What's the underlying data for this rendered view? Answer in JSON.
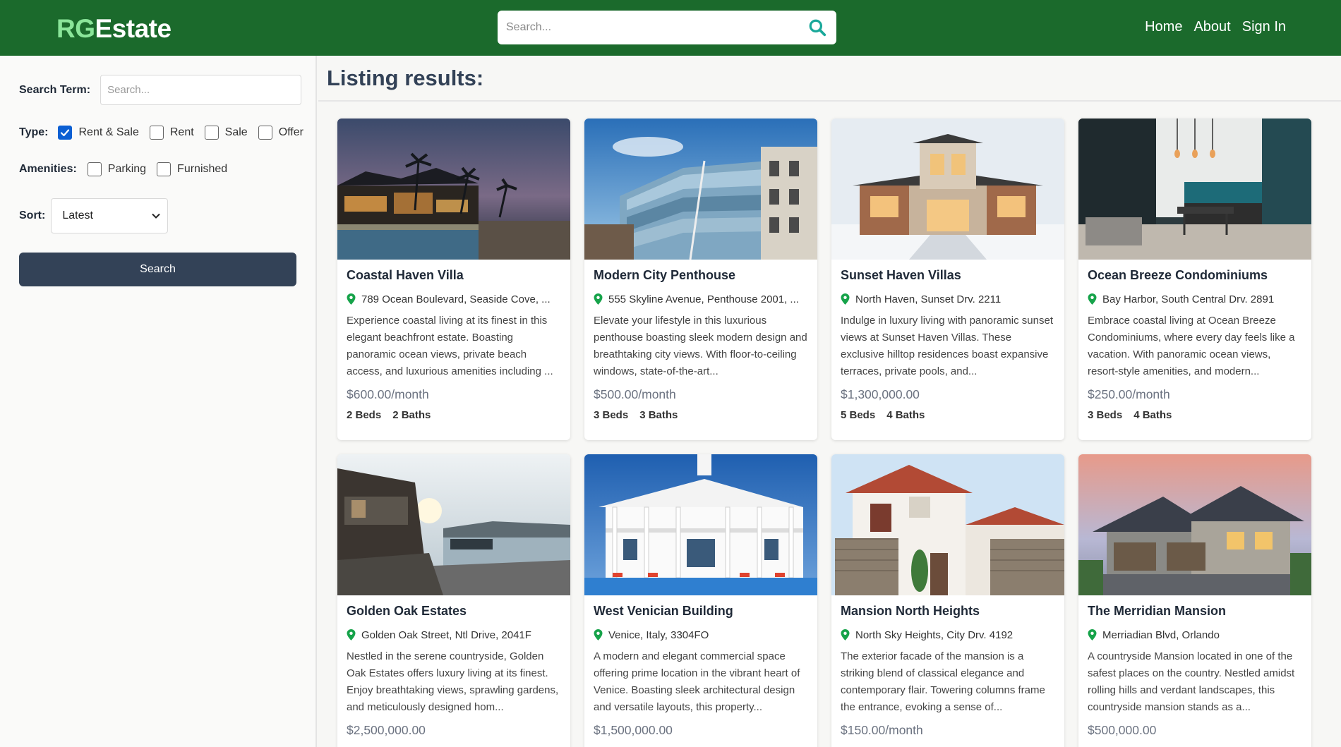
{
  "header": {
    "logo_part1": "RG",
    "logo_part2": "Estate",
    "search_placeholder": "Search...",
    "nav": [
      "Home",
      "About",
      "Sign In"
    ]
  },
  "filters": {
    "search_term_label": "Search Term:",
    "search_term_placeholder": "Search...",
    "type_label": "Type:",
    "types": [
      {
        "label": "Rent & Sale",
        "checked": true
      },
      {
        "label": "Rent",
        "checked": false
      },
      {
        "label": "Sale",
        "checked": false
      },
      {
        "label": "Offer",
        "checked": false
      }
    ],
    "amenities_label": "Amenities:",
    "amenities": [
      {
        "label": "Parking",
        "checked": false
      },
      {
        "label": "Furnished",
        "checked": false
      }
    ],
    "sort_label": "Sort:",
    "sort_selected": "Latest",
    "search_button": "Search"
  },
  "results": {
    "title": "Listing results:",
    "listings": [
      {
        "title": "Coastal Haven Villa",
        "address": "789 Ocean Boulevard, Seaside Cove, ...",
        "description": "Experience coastal living at its finest in this elegant beachfront estate. Boasting panoramic ocean views, private beach access, and luxurious amenities including ...",
        "price": "$600.00/month",
        "beds": "2 Beds",
        "baths": "2 Baths",
        "image": "resort-night-palms"
      },
      {
        "title": "Modern City Penthouse",
        "address": "555 Skyline Avenue, Penthouse 2001, ...",
        "description": "Elevate your lifestyle in this luxurious penthouse boasting sleek modern design and breathtaking city views. With floor-to-ceiling windows, state-of-the-art...",
        "price": "$500.00/month",
        "beds": "3 Beds",
        "baths": "3 Baths",
        "image": "glass-building"
      },
      {
        "title": "Sunset Haven Villas",
        "address": "North Haven, Sunset Drv. 2211",
        "description": "Indulge in luxury living with panoramic sunset views at Sunset Haven Villas. These exclusive hilltop residences boast expansive terraces, private pools, and...",
        "price": "$1,300,000.00",
        "beds": "5 Beds",
        "baths": "4 Baths",
        "image": "modern-house-snow"
      },
      {
        "title": "Ocean Breeze Condominiums",
        "address": "Bay Harbor, South Central Drv. 2891",
        "description": "Embrace coastal living at Ocean Breeze Condominiums, where every day feels like a vacation. With panoramic ocean views, resort-style amenities, and modern...",
        "price": "$250.00/month",
        "beds": "3 Beds",
        "baths": "4 Baths",
        "image": "interior-kitchen"
      },
      {
        "title": "Golden Oak Estates",
        "address": "Golden Oak Street, Ntl Drive, 2041F",
        "description": "Nestled in the serene countryside, Golden Oak Estates offers luxury living at its finest. Enjoy breathtaking views, sprawling gardens, and meticulously designed hom...",
        "price": "$2,500,000.00",
        "beds": "",
        "baths": "",
        "image": "lake-house-sunset"
      },
      {
        "title": "West Venician Building",
        "address": "Venice, Italy, 3304FO",
        "description": "A modern and elegant commercial space offering prime location in the vibrant heart of Venice. Boasting sleek architectural design and versatile layouts, this property...",
        "price": "$1,500,000.00",
        "beds": "",
        "baths": "",
        "image": "white-mansion-pool"
      },
      {
        "title": "Mansion North Heights",
        "address": "North Sky Heights, City Drv. 4192",
        "description": "The exterior facade of the mansion is a striking blend of classical elegance and contemporary flair. Towering columns frame the entrance, evoking a sense of...",
        "price": "$150.00/month",
        "beds": "",
        "baths": "",
        "image": "white-house-garage"
      },
      {
        "title": "The Merridian Mansion",
        "address": "Merriadian Blvd, Orlando",
        "description": "A countryside Mansion located in one of the safest places on the country. Nestled amidst rolling hills and verdant landscapes, this countryside mansion stands as a...",
        "price": "$500,000.00",
        "beds": "",
        "baths": "",
        "image": "suburban-house-dusk"
      }
    ]
  }
}
